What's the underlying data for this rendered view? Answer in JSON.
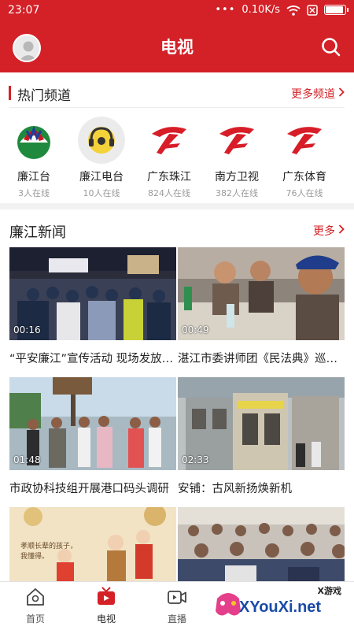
{
  "status_bar": {
    "time": "23:07",
    "dots": "•••",
    "network_speed": "0.10K/s",
    "battery_level": 0.85
  },
  "header": {
    "title": "电视"
  },
  "hot_channels": {
    "title": "热门频道",
    "more_label": "更多频道",
    "items": [
      {
        "name": "廉江台",
        "viewers": "3人在线"
      },
      {
        "name": "廉江电台",
        "viewers": "10人在线"
      },
      {
        "name": "广东珠江",
        "viewers": "824人在线"
      },
      {
        "name": "南方卫视",
        "viewers": "382人在线"
      },
      {
        "name": "广东体育",
        "viewers": "76人在线"
      }
    ]
  },
  "news": {
    "title": "廉江新闻",
    "more_label": "更多",
    "videos": [
      {
        "title": "“平安廉江”宣传活动 现场发放宣传资料",
        "duration": "00:16"
      },
      {
        "title": "湛江市委讲师团《民法典》巡回宣讲",
        "duration": "00:49"
      },
      {
        "title": "市政协科技组开展港口码头调研",
        "duration": "01:48"
      },
      {
        "title": "安铺：古风新扬焕新机",
        "duration": "02:33"
      },
      {
        "title": "",
        "duration": ""
      },
      {
        "title": "",
        "duration": ""
      }
    ],
    "thumb5_caption": "孝顺长辈的孩子，我懂得。"
  },
  "bottom_nav": {
    "items": [
      {
        "label": "首页"
      },
      {
        "label": "电视"
      },
      {
        "label": "直播"
      }
    ]
  },
  "watermark": {
    "text": "XYouXi.net",
    "small": "X游戏"
  },
  "colors": {
    "brand_red": "#d32127",
    "text_gray": "#9a9a9a"
  }
}
